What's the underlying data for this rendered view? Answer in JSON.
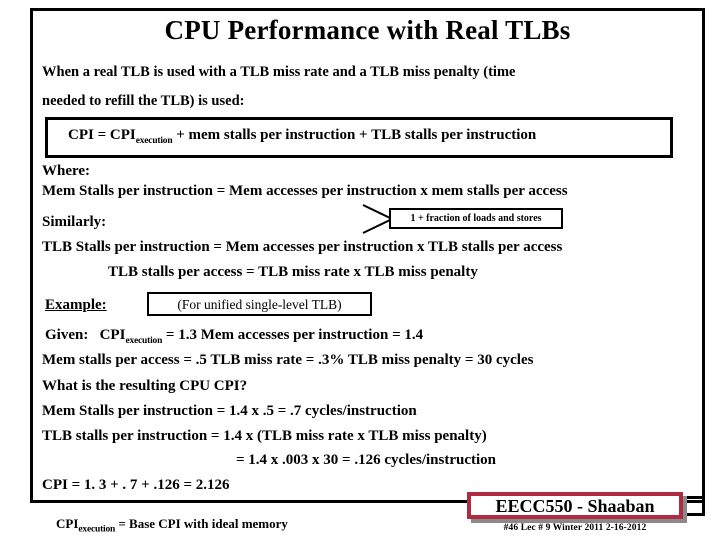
{
  "slide": {
    "title": "CPU Performance with Real TLBs",
    "intro": [
      "When a real TLB is used with a TLB miss rate and a TLB miss penalty (time",
      "needed to refill the TLB) is used:"
    ],
    "equation_box": {
      "prefix": "CPI =  CPI",
      "subscript": "execution",
      "suffix": "  +  mem stalls per instruction  +  TLB stalls per instruction"
    },
    "where_label": "Where:",
    "mem_stalls_def": "Mem Stalls per instruction =   Mem accesses per instruction  x  mem stalls per access",
    "loads_stores_callout": "1 + fraction of loads and stores",
    "similarly_label": "Similarly:",
    "tlb_stalls_def": "TLB  Stalls per instruction =   Mem accesses per instruction  x  TLB stalls per access",
    "tlb_stalls_access": "TLB stalls per access =  TLB miss rate  x  TLB miss penalty",
    "example_label": "Example:",
    "tlb_note": "(For unified single-level TLB)",
    "given": {
      "label": "Given:",
      "cpi_prefix": "CPI",
      "cpi_subscript": "execution",
      "cpi_value": " = 1.3    Mem accesses per instruction = 1.4"
    },
    "given_line2": "Mem stalls per access =  .5        TLB miss rate  =  .3%   TLB miss penalty =  30 cycles",
    "question": "What is the resulting CPU CPI?",
    "solution": [
      "Mem Stalls per instruction  =  1.4 x  .5  =  .7    cycles/instruction",
      "TLB stalls per instruction  =  1.4  x   (TLB miss rate  x  TLB miss penalty)",
      "=  1.4 x .003 x 30  =  .126 cycles/instruction",
      "CPI  =  1. 3  +  . 7  +  .126   =    2.126"
    ],
    "footer_note": {
      "prefix": "CPI",
      "subscript": "execution",
      "suffix": " =  Base CPI with ideal memory"
    },
    "footer_badge": "EECC550 - Shaaban",
    "footer_meta": "#46   Lec # 9  Winter 2011  2-16-2012"
  },
  "colors": {
    "badge_border": "#B02A41",
    "frame": "#000000",
    "text": "#000000",
    "background": "#ffffff"
  }
}
